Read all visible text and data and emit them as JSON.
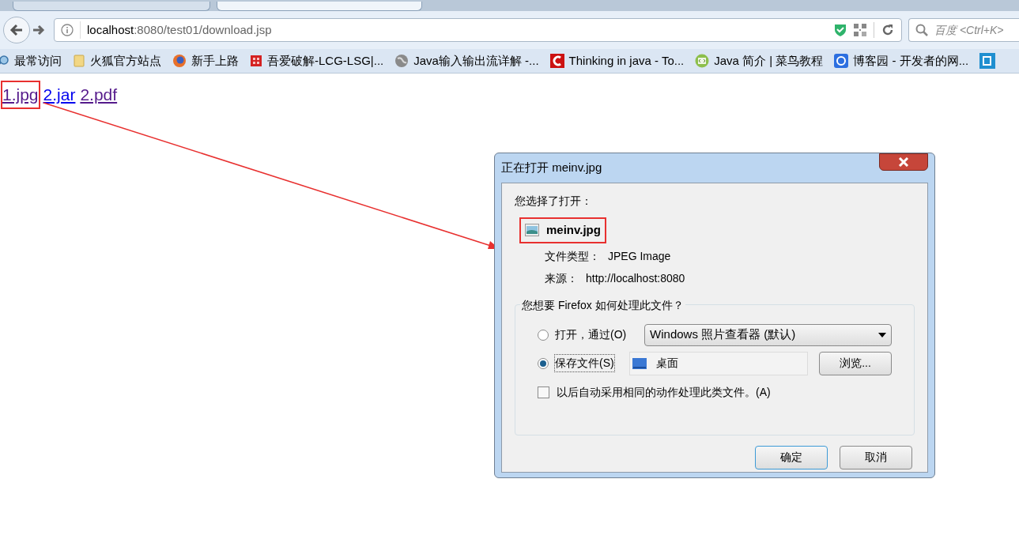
{
  "browser": {
    "url": {
      "host": "localhost",
      "rest": ":8080/test01/download.jsp"
    },
    "search": {
      "placeholder": "百度 <Ctrl+K>"
    },
    "bookmarks": [
      {
        "label": "最常访问"
      },
      {
        "label": "火狐官方站点"
      },
      {
        "label": "新手上路"
      },
      {
        "label": "吾爱破解-LCG-LSG|..."
      },
      {
        "label": "Java输入输出流详解 -..."
      },
      {
        "label": "Thinking in java - To..."
      },
      {
        "label": "Java 简介 | 菜鸟教程"
      },
      {
        "label": "博客园 - 开发者的网..."
      }
    ]
  },
  "page": {
    "links": [
      {
        "label": "1.jpg",
        "visited": true,
        "highlighted": true
      },
      {
        "label": "2.jar",
        "visited": false,
        "highlighted": false
      },
      {
        "label": "2.pdf",
        "visited": true,
        "highlighted": false
      }
    ]
  },
  "dialog": {
    "title": "正在打开 meinv.jpg",
    "intro": "您选择了打开：",
    "file_name": "meinv.jpg",
    "details": [
      {
        "label": "文件类型：",
        "value": "JPEG Image"
      },
      {
        "label": "来源：",
        "value": "http://localhost:8080"
      }
    ],
    "group_title": "您想要 Firefox 如何处理此文件？",
    "options": [
      {
        "kind": "open",
        "label": "打开，通过(O)",
        "selected": false,
        "value": "Windows 照片查看器 (默认)"
      },
      {
        "kind": "save",
        "label": "保存文件(S)",
        "selected": true,
        "value": "桌面",
        "button": "浏览..."
      }
    ],
    "remember": {
      "label": "以后自动采用相同的动作处理此类文件。(A)",
      "checked": false
    },
    "buttons": [
      {
        "label": "确定",
        "default": true
      },
      {
        "label": "取消",
        "default": false
      }
    ]
  }
}
